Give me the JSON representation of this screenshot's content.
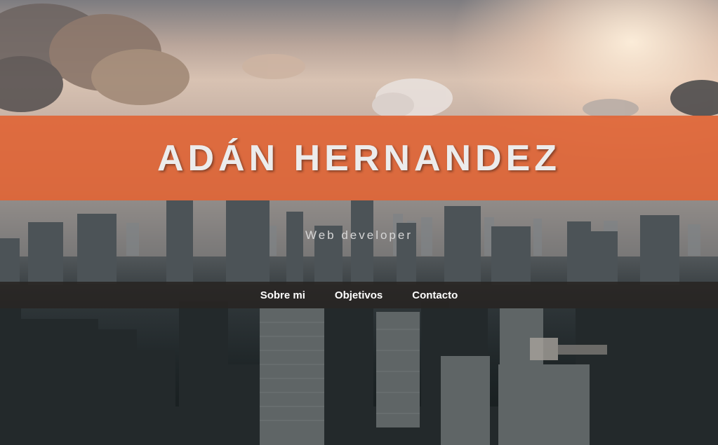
{
  "header": {
    "title": "ADÁN HERNANDEZ",
    "subtitle": "Web developer"
  },
  "nav": {
    "items": [
      {
        "label": "Sobre mi"
      },
      {
        "label": "Objetivos"
      },
      {
        "label": "Contacto"
      }
    ]
  },
  "colors": {
    "banner": "#e06638",
    "navbar": "#282422",
    "title_text": "#ececec",
    "nav_text": "#ffffff"
  }
}
